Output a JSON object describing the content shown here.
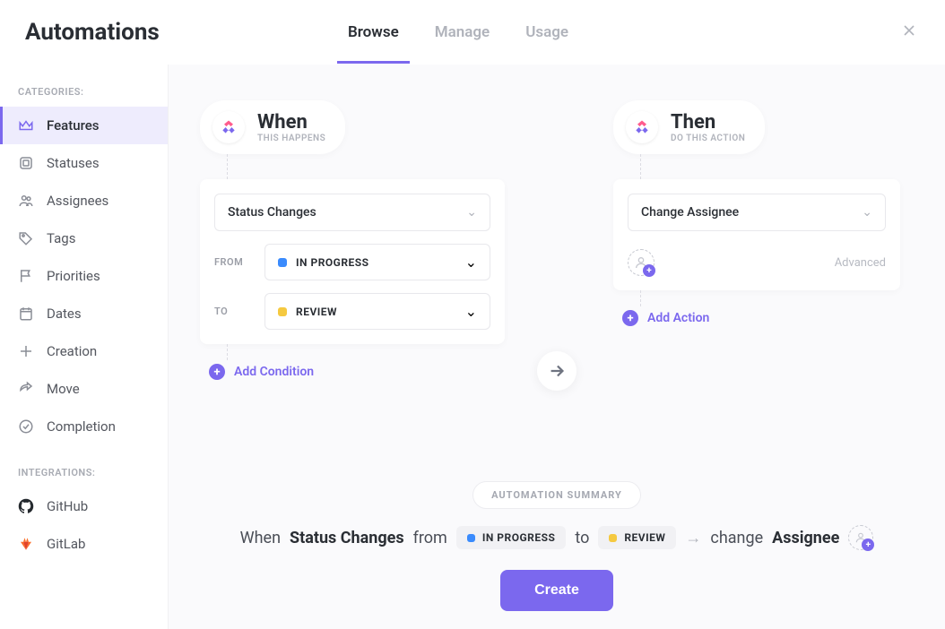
{
  "header": {
    "title": "Automations",
    "tabs": [
      {
        "label": "Browse",
        "active": true
      },
      {
        "label": "Manage",
        "active": false
      },
      {
        "label": "Usage",
        "active": false
      }
    ]
  },
  "sidebar": {
    "section_categories": "CATEGORIES:",
    "section_integrations": "INTEGRATIONS:",
    "categories": [
      {
        "label": "Features",
        "active": true
      },
      {
        "label": "Statuses"
      },
      {
        "label": "Assignees"
      },
      {
        "label": "Tags"
      },
      {
        "label": "Priorities"
      },
      {
        "label": "Dates"
      },
      {
        "label": "Creation"
      },
      {
        "label": "Move"
      },
      {
        "label": "Completion"
      }
    ],
    "integrations": [
      {
        "label": "GitHub"
      },
      {
        "label": "GitLab"
      }
    ]
  },
  "when": {
    "title": "When",
    "subtitle": "THIS HAPPENS",
    "trigger": "Status Changes",
    "from_label": "FROM",
    "from_value": "IN PROGRESS",
    "from_color": "#3a8bfd",
    "to_label": "TO",
    "to_value": "REVIEW",
    "to_color": "#f5c940",
    "add_condition": "Add Condition"
  },
  "then": {
    "title": "Then",
    "subtitle": "DO THIS ACTION",
    "action": "Change Assignee",
    "advanced": "Advanced",
    "add_action": "Add Action"
  },
  "summary": {
    "badge": "AUTOMATION SUMMARY",
    "when": "When",
    "status_changes": "Status Changes",
    "from": "from",
    "from_value": "IN PROGRESS",
    "from_color": "#3a8bfd",
    "to": "to",
    "to_value": "REVIEW",
    "to_color": "#f5c940",
    "change": "change",
    "assignee": "Assignee",
    "create": "Create"
  }
}
